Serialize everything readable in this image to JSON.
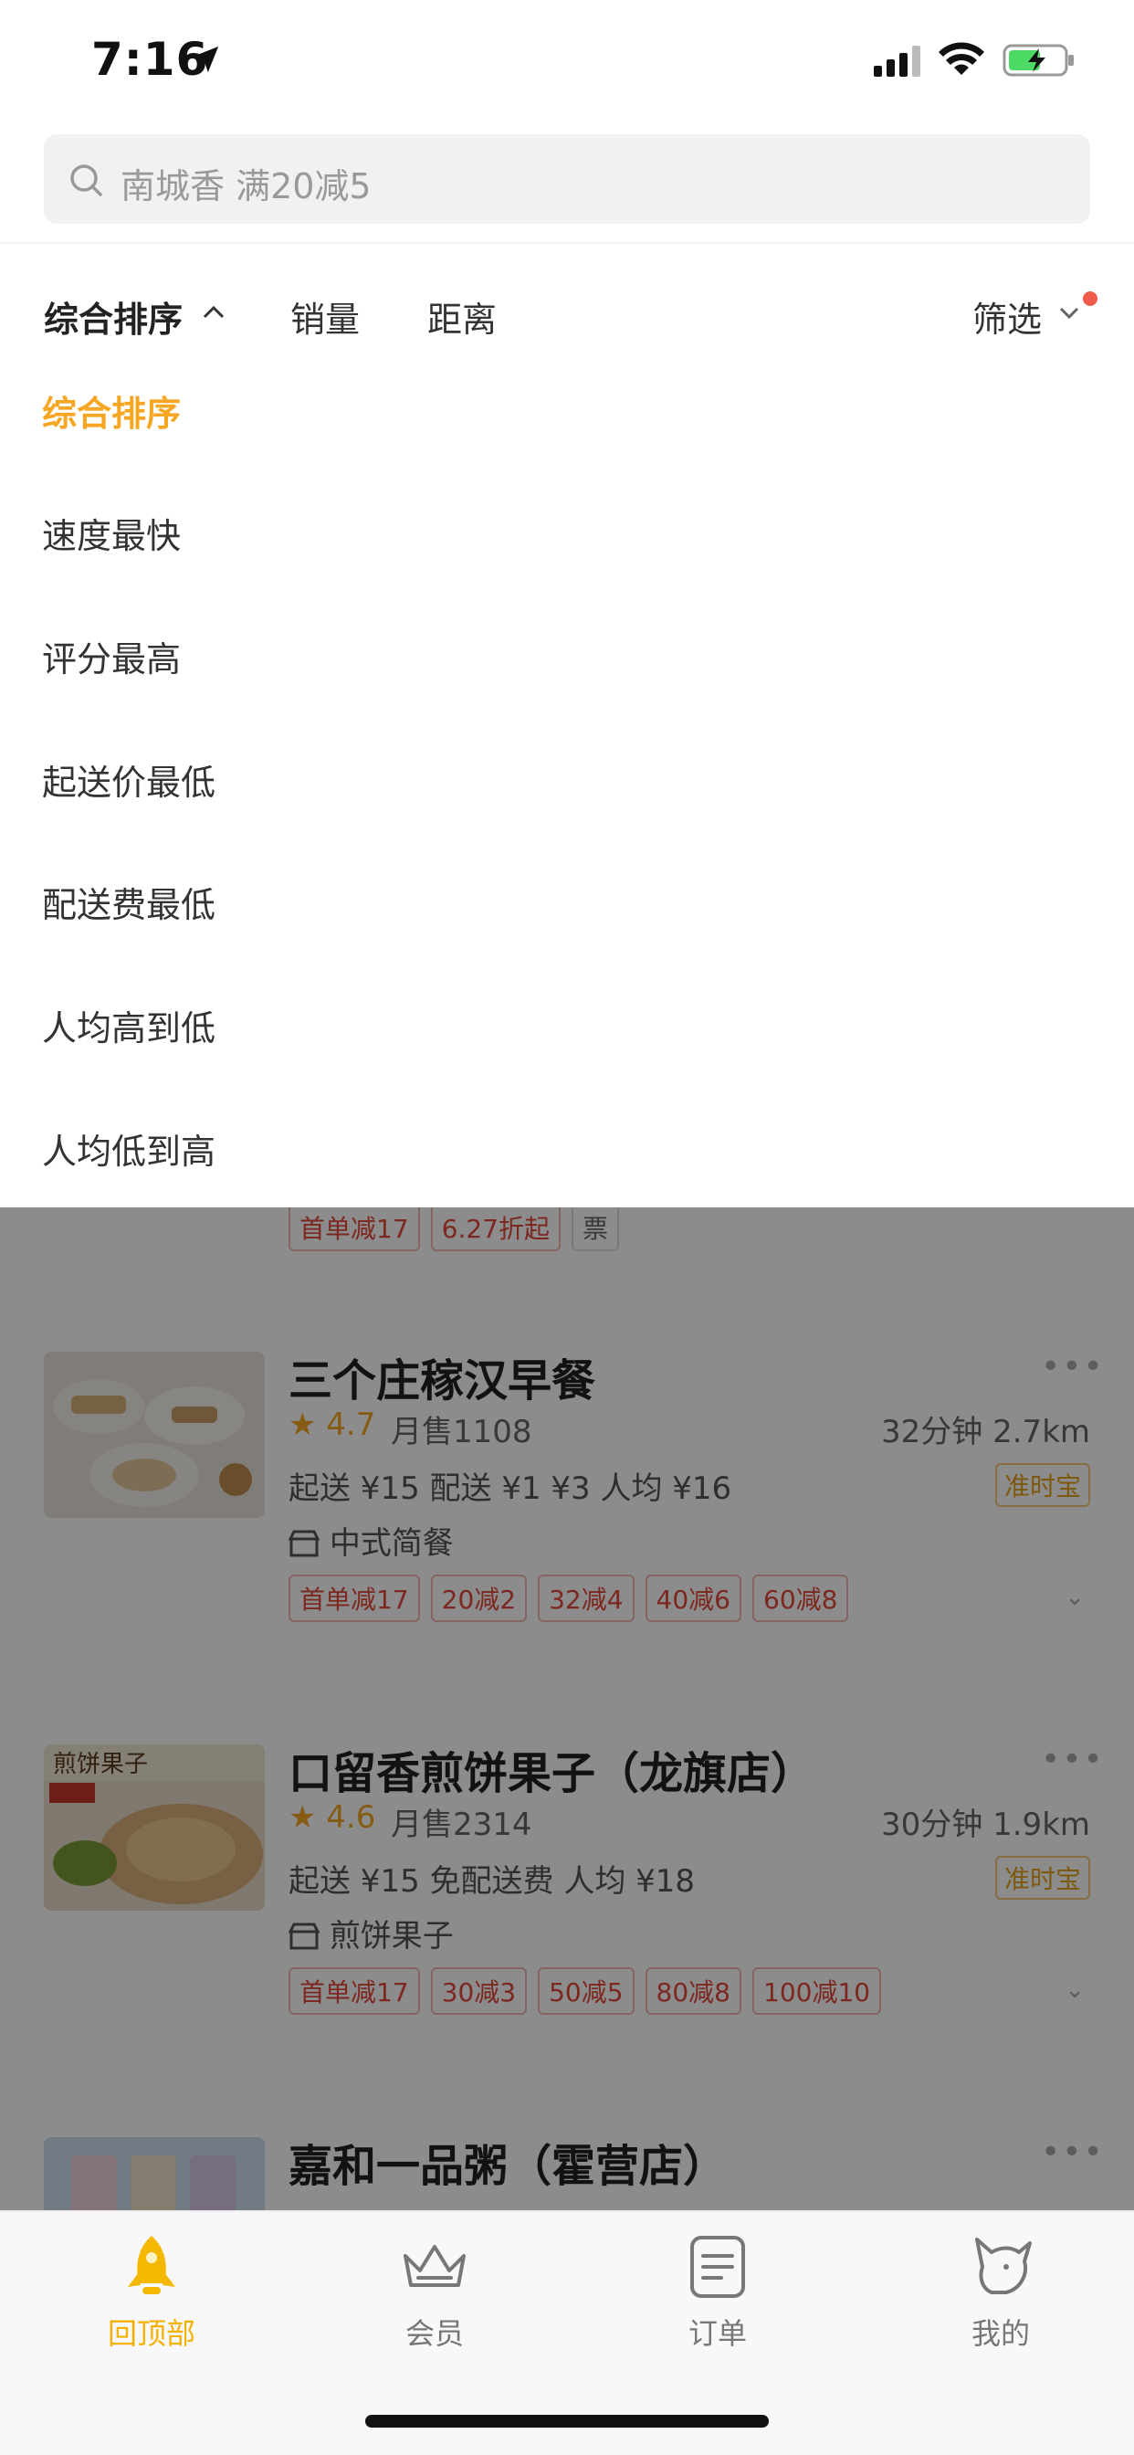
{
  "status_bar": {
    "time": "7:16"
  },
  "search": {
    "placeholder": "南城香 满20减5"
  },
  "sort_bar": {
    "main": "综合排序",
    "sales": "销量",
    "distance": "距离",
    "filter": "筛选"
  },
  "dropdown": {
    "options": [
      "综合排序",
      "速度最快",
      "评分最高",
      "起送价最低",
      "配送费最低",
      "人均高到低",
      "人均低到高"
    ],
    "selected_index": 0
  },
  "list": {
    "partial_tags": [
      "首单减17",
      "6.27折起",
      "票"
    ],
    "restaurants": [
      {
        "name": "三个庄稼汉早餐",
        "rating": "★ 4.7",
        "monthly": "月售1108",
        "eta": "32分钟 2.7km",
        "fees": "起送 ¥15   配送 ¥1 ¥3   人均 ¥16",
        "badge": "准时宝",
        "cuisine": "中式简餐",
        "tags": [
          "首单减17",
          "20减2",
          "32减4",
          "40减6",
          "60减8"
        ]
      },
      {
        "name": "口留香煎饼果子（龙旗店）",
        "rating": "★ 4.6",
        "monthly": "月售2314",
        "eta": "30分钟 1.9km",
        "fees": "起送 ¥15   免配送费   人均 ¥18",
        "badge": "准时宝",
        "cuisine": "煎饼果子",
        "tags": [
          "首单减17",
          "30减3",
          "50减5",
          "80减8",
          "100减10"
        ]
      },
      {
        "name": "嘉和一品粥（霍营店）"
      }
    ]
  },
  "tab_bar": {
    "tabs": [
      {
        "label": "回顶部",
        "icon": "rocket-icon",
        "active": true
      },
      {
        "label": "会员",
        "icon": "crown-icon",
        "active": false
      },
      {
        "label": "订单",
        "icon": "order-list-icon",
        "active": false
      },
      {
        "label": "我的",
        "icon": "profile-icon",
        "active": false
      }
    ]
  },
  "colors": {
    "accent": "#f5a623",
    "tag_red": "#e2473a",
    "dot_red": "#f05a4a"
  }
}
